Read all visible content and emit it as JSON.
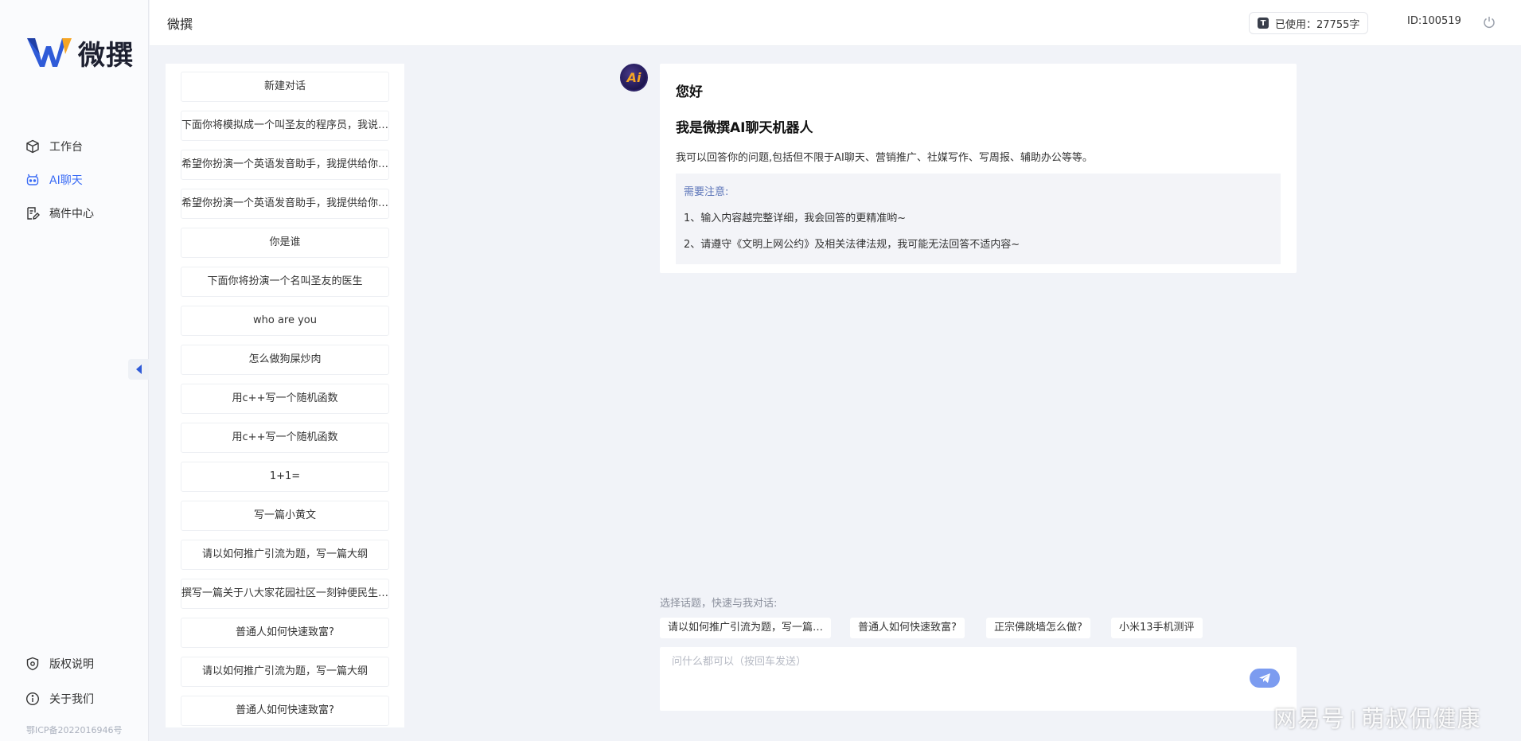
{
  "brand": {
    "name": "微撰"
  },
  "header": {
    "title": "微撰",
    "usage_text": "已使用：27755字",
    "user_id": "ID:100519"
  },
  "nav": {
    "items": [
      {
        "label": "工作台",
        "icon": "cube-icon"
      },
      {
        "label": "AI聊天",
        "icon": "robot-icon",
        "active": true
      },
      {
        "label": "稿件中心",
        "icon": "document-edit-icon"
      }
    ],
    "bottom": [
      {
        "label": "版权说明",
        "icon": "shield-icon"
      },
      {
        "label": "关于我们",
        "icon": "info-icon"
      }
    ],
    "icp": "鄂ICP备2022016946号"
  },
  "conversations": {
    "items": [
      "新建对话",
      "下面你将模拟成一个叫圣友的程序员，我说…",
      "希望你扮演一个英语发音助手，我提供给你…",
      "希望你扮演一个英语发音助手，我提供给你…",
      "你是谁",
      "下面你将扮演一个名叫圣友的医生",
      "who are you",
      "怎么做狗屎炒肉",
      "用c++写一个随机函数",
      "用c++写一个随机函数",
      "1+1=",
      "写一篇小黄文",
      "请以如何推广引流为题，写一篇大纲",
      "撰写一篇关于八大家花园社区一刻钟便民生…",
      "普通人如何快速致富?",
      "请以如何推广引流为题，写一篇大纲",
      "普通人如何快速致富?"
    ]
  },
  "chat": {
    "avatar_text": "Ai",
    "hello": "您好",
    "intro_title": "我是微撰AI聊天机器人",
    "intro_desc": "我可以回答你的问题,包括但不限于AI聊天、营销推广、社媒写作、写周报、辅助办公等等。",
    "notice_title": "需要注意:",
    "notice_lines": [
      "1、输入内容越完整详细，我会回答的更精准哟~",
      "2、请遵守《文明上网公约》及相关法律法规，我可能无法回答不适内容~"
    ]
  },
  "topics": {
    "label": "选择话题，快速与我对话:",
    "items": [
      "请以如何推广引流为题，写一篇…",
      "普通人如何快速致富?",
      "正宗佛跳墙怎么做?",
      "小米13手机测评"
    ]
  },
  "input": {
    "placeholder": "问什么都可以（按回车发送）"
  },
  "watermark": {
    "left": "网易号",
    "right": "萌叔侃健康"
  },
  "colors": {
    "accent": "#3b6cf5",
    "send_button": "#7c9cf0",
    "notice_title": "#5b74b8"
  }
}
